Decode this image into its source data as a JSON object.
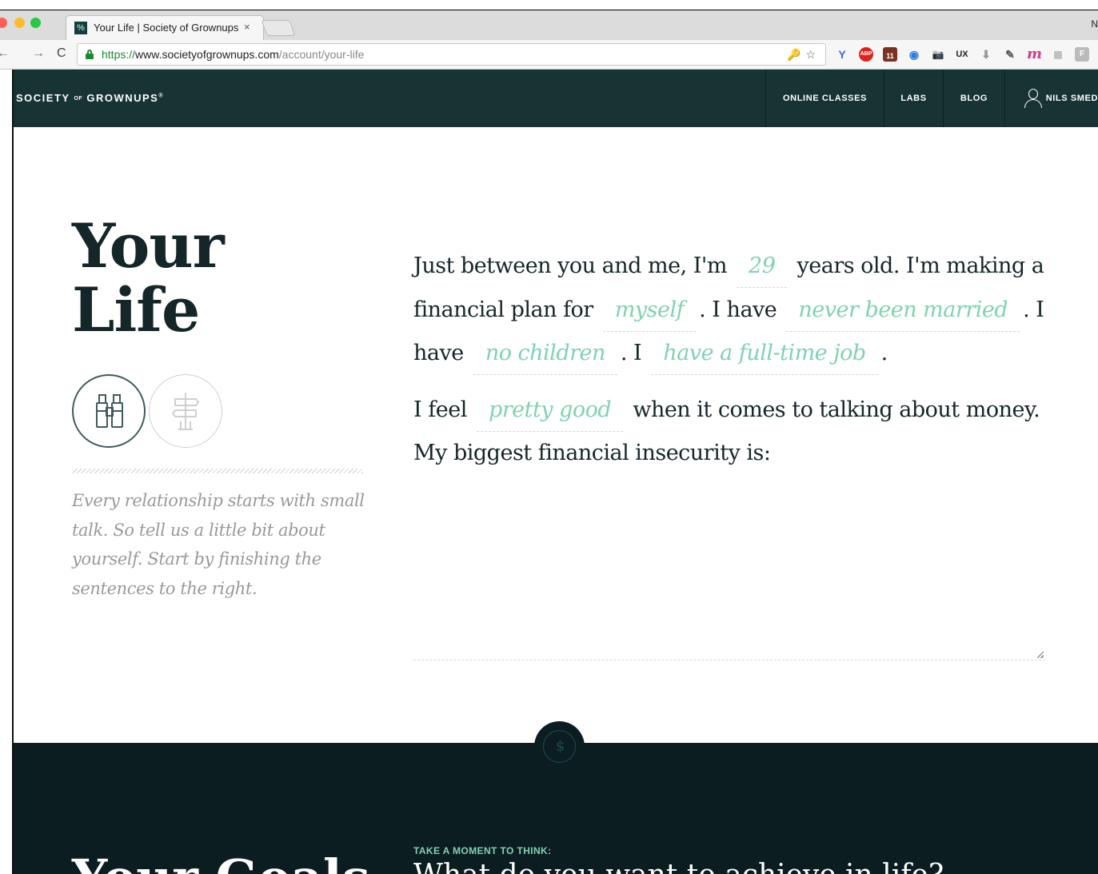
{
  "browser": {
    "tab_title": "Your Life | Society of Grownups",
    "tab_favicon": "%",
    "tab_close": "×",
    "window_edge_letter": "N",
    "url_scheme": "https://",
    "url_host": "www.societyofgrownups.com",
    "url_path": "/account/your-life",
    "nav_back": "←",
    "nav_forward": "→",
    "nav_reload": "C",
    "omnibox_icons": "🔑☆",
    "extension_labels": [
      "Y",
      "ABP",
      "11",
      "◉",
      "📷",
      "UX",
      "⬇",
      "✎",
      "m",
      "▦",
      "F"
    ]
  },
  "header": {
    "logo_main_1": "SOCIETY",
    "logo_of": "OF",
    "logo_main_2": "GROWNUPS",
    "logo_mark": "®",
    "nav": {
      "online_classes": "ONLINE CLASSES",
      "labs": "LABS",
      "blog": "BLOG",
      "user": "NILS SMED"
    }
  },
  "page": {
    "title_line1": "Your",
    "title_line2": "Life",
    "intro": "Every relationship starts with small talk. So tell us a little bit about yourself. Start by finishing the sentences to the right."
  },
  "form": {
    "s1_pre": "Just between you and me, I'm",
    "age": "29",
    "s1_post": "years old. I'm making a financial plan for",
    "plan_for": "myself",
    "s2": ". I have",
    "marital_status": "never been married",
    "s3": ". I have",
    "children": "no children",
    "s4": ". I",
    "employment": "have a full-time job",
    "s5": ".",
    "s6_pre": "I feel",
    "feeling": "pretty good",
    "s6_post": "when it comes to talking about money. My biggest financial insecurity is:",
    "insecurity_value": ""
  },
  "goals": {
    "divider_glyph": "$",
    "title": "Your Goals",
    "kicker": "TAKE A MOMENT TO THINK:",
    "question": "What do you want to achieve in life?"
  },
  "colors": {
    "header_bg": "#173334",
    "accent_green": "#7fd3b0",
    "dark_section_bg": "#0b1d20",
    "title_text": "#152628"
  }
}
